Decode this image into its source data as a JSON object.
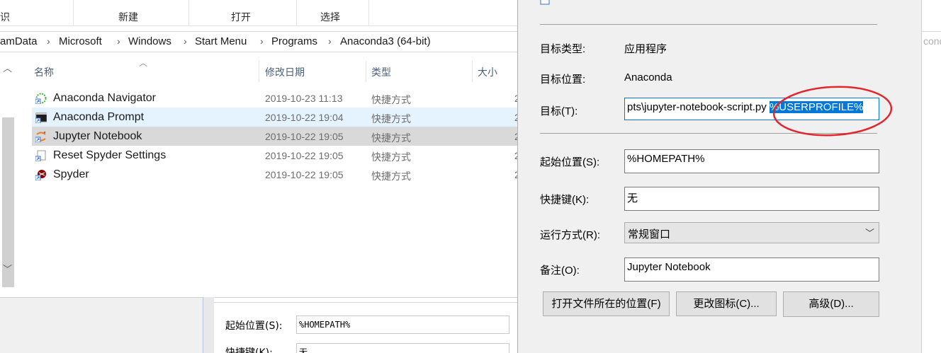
{
  "explorer": {
    "ribbon": {
      "left_clip": "识",
      "new_label": "新建",
      "open_label": "打开",
      "select_label": "选择"
    },
    "breadcrumb": [
      "amData",
      "Microsoft",
      "Windows",
      "Start Menu",
      "Programs",
      "Anaconda3 (64-bit)"
    ],
    "columns": {
      "name": "名称",
      "modified": "修改日期",
      "type": "类型",
      "size": "大小"
    },
    "files": [
      {
        "name": "Anaconda Navigator",
        "date": "2019-10-23 11:13",
        "type": "快捷方式",
        "size": "2",
        "icon": "anaconda-navigator-icon"
      },
      {
        "name": "Anaconda Prompt",
        "date": "2019-10-22 19:04",
        "type": "快捷方式",
        "size": "2",
        "icon": "terminal-icon"
      },
      {
        "name": "Jupyter Notebook",
        "date": "2019-10-22 19:05",
        "type": "快捷方式",
        "size": "2",
        "icon": "jupyter-icon"
      },
      {
        "name": "Reset Spyder Settings",
        "date": "2019-10-22 19:05",
        "type": "快捷方式",
        "size": "2",
        "icon": "shortcut-icon"
      },
      {
        "name": "Spyder",
        "date": "2019-10-22 19:05",
        "type": "快捷方式",
        "size": "2",
        "icon": "spyder-icon"
      }
    ],
    "lower_dialog": {
      "start_label": "起始位置(S):",
      "start_value": "%HOMEPATH%",
      "hotkey_label": "快捷键(K):",
      "hotkey_value": "无"
    }
  },
  "properties": {
    "target_type_label": "目标类型:",
    "target_type_value": "应用程序",
    "target_location_label": "目标位置:",
    "target_location_value": "Anaconda",
    "target_label": "目标(T):",
    "target_value_prefix": "pts\\jupyter-notebook-script.py ",
    "target_value_selected": "%USERPROFILE%",
    "start_in_label": "起始位置(S):",
    "start_in_value": "%HOMEPATH%",
    "hotkey_label": "快捷键(K):",
    "hotkey_value": "无",
    "run_label": "运行方式(R):",
    "run_value": "常规窗口",
    "comment_label": "备注(O):",
    "comment_value": "Jupyter Notebook",
    "open_location_button": "打开文件所在的位置(F)",
    "change_icon_button": "更改图标(C)...",
    "advanced_button": "高级(D)..."
  },
  "right_edge": {
    "address_clip": "cond"
  },
  "colors": {
    "selected_row": "#cce8ff",
    "hover_row": "#d9d9d9",
    "accent": "#0078d7",
    "annotation_circle": "#e0282e"
  }
}
